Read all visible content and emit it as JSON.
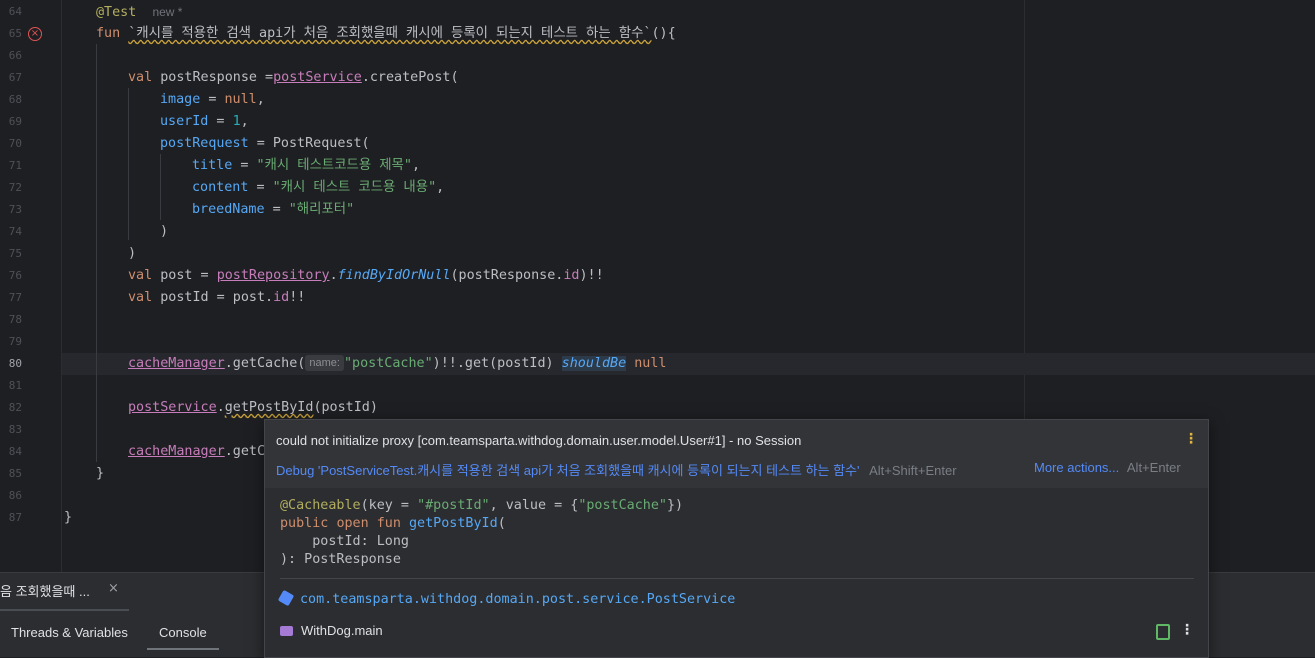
{
  "editor": {
    "line_numbers": [
      "64",
      "65",
      "66",
      "67",
      "68",
      "69",
      "70",
      "71",
      "72",
      "73",
      "74",
      "75",
      "76",
      "77",
      "78",
      "79",
      "80",
      "81",
      "82",
      "83",
      "84",
      "85",
      "86",
      "87"
    ],
    "current_line": "80",
    "annotation": "@Test",
    "new_tag": "new *",
    "fun_kw": "fun",
    "fun_name": "`캐시를 적용한 검색 api가 처음 조회했을때 캐시에 등록이 되는지 테스트 하는 함수`",
    "fun_tail": "(){",
    "val_kw": "val",
    "post_response": " postResponse =",
    "post_service": "postService",
    "create_post": ".createPost(",
    "image_name": "image",
    "image_eq": " = ",
    "null_kw": "null",
    "comma": ",",
    "userid_name": "userId",
    "userid_eq": " = ",
    "userid_val": "1",
    "postrequest_name": "postRequest",
    "postrequest_eq": " = PostRequest(",
    "title_name": "title",
    "title_eq": " = ",
    "title_val": "\"캐시 테스트코드용 제목\"",
    "content_name": "content",
    "content_eq": " = ",
    "content_val": "\"캐시 테스트 코드용 내용\"",
    "breed_name": "breedName",
    "breed_eq": " = ",
    "breed_val": "\"해리포터\"",
    "close_paren": ")",
    "post_decl": " post = ",
    "post_repository": "postRepository",
    "dot": ".",
    "find_by_id": "findByIdOrNull",
    "find_args_a": "(postResponse.",
    "id_prop": "id",
    "find_args_b": ")!!",
    "postid_decl": " postId = post.",
    "bangs": "!!",
    "cache_manager": "cacheManager",
    "get_cache": ".getCache(",
    "name_hint": "name:",
    "post_cache_str": "\"postCache\"",
    "get_postid": ")!!.get(postId) ",
    "should_be": "shouldBe",
    "space": " ",
    "get_post_by_id": "getPostById",
    "postid_arg": "(postId)",
    "cache_manager_2": "cacheManager",
    "get_c": ".getC",
    "close_brace": "}"
  },
  "popup": {
    "error_message": "could not initialize proxy [com.teamsparta.withdog.domain.user.model.User#1] - no Session",
    "kebab": "⋮",
    "debug_link": "Debug 'PostServiceTest.캐시를 적용한 검색 api가 처음 조회했을때 캐시에 등록이 되는지 테스트 하는 함수'",
    "debug_shortcut": "Alt+Shift+Enter",
    "more_actions": "More actions...",
    "more_shortcut": "Alt+Enter",
    "doc_annotation": "@Cacheable",
    "doc_key_open": "(key = ",
    "doc_key_val": "\"#postId\"",
    "doc_value_part": ", value = {",
    "doc_value_val": "\"postCache\"",
    "doc_value_close": "})",
    "doc_public": "public",
    "doc_open": "open",
    "doc_fun": "fun",
    "doc_fname": "getPostById",
    "doc_fparen": "(",
    "doc_param": "    postId: Long",
    "doc_return": "): PostResponse",
    "package": "com.teamsparta.withdog.domain.post.service.PostService",
    "module": "WithDog.main"
  },
  "debug_panel": {
    "session_tab": "음 조회했을때 ...",
    "close_icon": "×",
    "tabs": [
      "Threads & Variables",
      "Console"
    ]
  }
}
